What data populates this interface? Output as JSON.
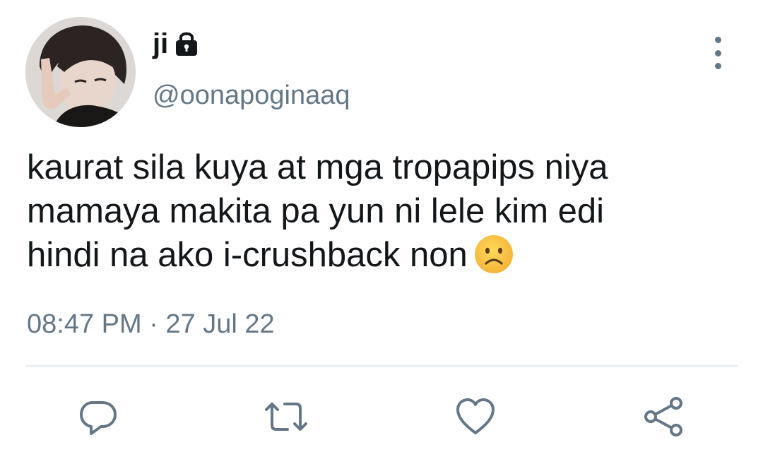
{
  "tweet": {
    "display_name": "ji",
    "handle": "@oonapoginaaq",
    "text_lines": [
      "kaurat sila kuya at mga tropapips niya",
      "mamaya makita pa yun ni lele kim edi",
      "hindi na ako i-crushback non"
    ],
    "emoji": "☹️",
    "timestamp": "08:47 PM · 27 Jul 22"
  },
  "icons": {
    "lock": "lock-icon",
    "more": "more-vertical-icon",
    "reply": "reply-icon",
    "retweet": "retweet-icon",
    "like": "heart-icon",
    "share": "share-icon",
    "emoji": "frowning-face-emoji"
  },
  "colors": {
    "text": "#14171a",
    "secondary": "#657786",
    "divider": "#e6ecf0",
    "icon": "#657786"
  }
}
